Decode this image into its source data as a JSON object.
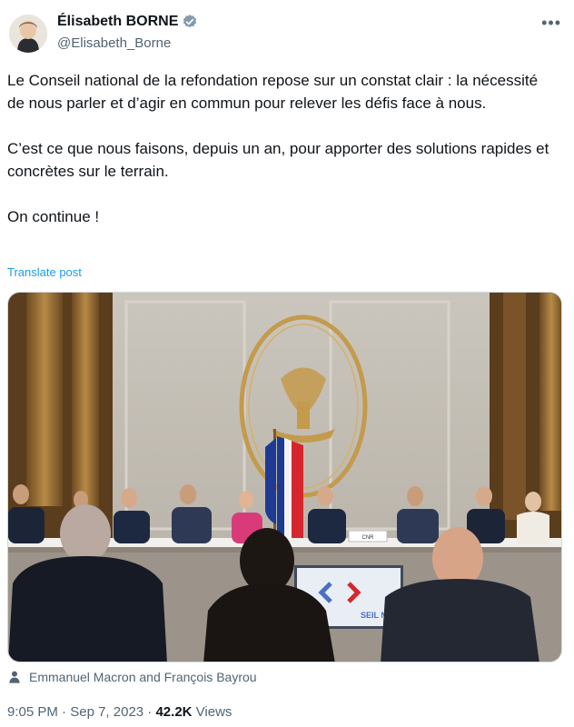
{
  "author": {
    "display_name": "Élisabeth BORNE",
    "handle": "@Elisabeth_Borne",
    "verified": true,
    "verified_color": "#829aab",
    "avatar_icon": "profile-photo"
  },
  "more_icon": "more-horizontal-icon",
  "tweet": {
    "text": "Le Conseil national de la refondation repose sur un constat clair : la nécessité de nous parler et d’agir en commun pour relever les défis face à nous.\n\nC’est ce que nous faisons, depuis un an, pour apporter des solutions rapides et concrètes sur le terrain.\n\nOn continue !",
    "translate_label": "Translate post"
  },
  "media": {
    "alt": "Government meeting in a gilded hall with French and EU flags",
    "nameplate_text": "CNR",
    "banner_text": "SEIL NATION"
  },
  "tagged": {
    "icon": "person-icon",
    "text": "Emmanuel Macron and François Bayrou"
  },
  "meta": {
    "time": "9:05 PM",
    "date": "Sep 7, 2023",
    "views_count": "42.2K",
    "views_label": "Views"
  },
  "colors": {
    "text": "#0f1419",
    "secondary": "#536471",
    "link": "#1d9bf0"
  }
}
